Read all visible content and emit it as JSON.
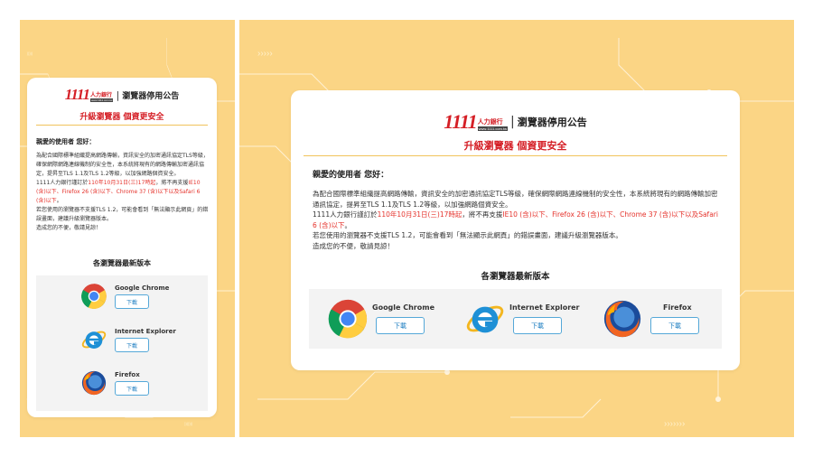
{
  "logo": {
    "number": "1111",
    "brand_cn": "人力銀行",
    "brand_url": "www.1111.com.tw",
    "separator": "|",
    "notice": "瀏覽器停用公告"
  },
  "subtitle": "升級瀏覽器 個資更安全",
  "greeting": "親愛的使用者 您好：",
  "paragraphs": {
    "p1": "為配合國際標準組織提高網路傳輸，資訊安全的加密通訊協定TLS等級，確保網際網路連線機制的安全性，本系統將現有的網路傳輸加密通訊協定，提昇至TLS 1.1及TLS 1.2等級，以加強網路個資安全。",
    "p2_lead": "1111人力銀行謹訂於",
    "p2_date": "110年10月31日(三)17時起",
    "p2_mid": "，將不再支援",
    "p2_versions": "IE10 (含)以下、Firefox 26 (含)以下、Chrome 37 (含)以下以及Safari 6 (含)以下",
    "p2_end": "。",
    "p3": "若您使用的瀏覽器不支援TLS 1.2，可能會看到「無法顯示此網頁」的錯誤畫面，建議升級瀏覽器版本。",
    "p4": "造成您的不便，敬請見諒！"
  },
  "section_title": "各瀏覽器最新版本",
  "browsers": [
    {
      "name": "Google Chrome",
      "icon": "chrome-icon",
      "button": "下載"
    },
    {
      "name": "Internet Explorer",
      "icon": "internet-explorer-icon",
      "button": "下載"
    },
    {
      "name": "Firefox",
      "icon": "firefox-icon",
      "button": "下載"
    }
  ],
  "colors": {
    "background": "#fbd585",
    "accent_red": "#d51f26",
    "button_blue": "#1f7fc2"
  }
}
